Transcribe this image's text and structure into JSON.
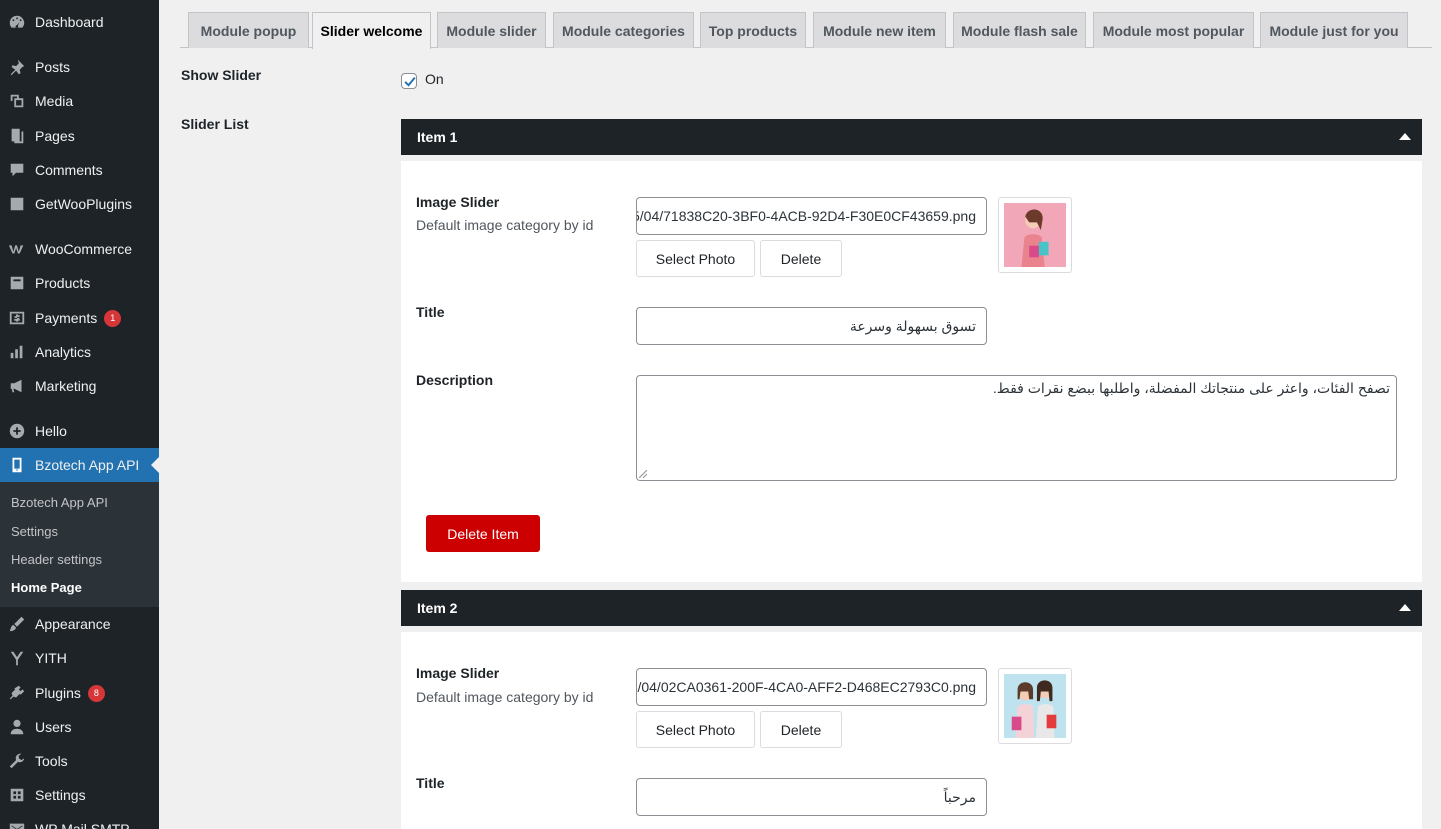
{
  "sidebar": {
    "items": [
      {
        "label": "Dashboard",
        "icon": "dashboard-icon"
      },
      {
        "label": "Posts",
        "icon": "pin-icon"
      },
      {
        "label": "Media",
        "icon": "media-icon"
      },
      {
        "label": "Pages",
        "icon": "pages-icon"
      },
      {
        "label": "Comments",
        "icon": "comment-icon"
      },
      {
        "label": "GetWooPlugins",
        "icon": "chart-icon"
      },
      {
        "label": "WooCommerce",
        "icon": "woo-icon"
      },
      {
        "label": "Products",
        "icon": "archive-icon"
      },
      {
        "label": "Payments",
        "icon": "payment-icon",
        "badge": "1"
      },
      {
        "label": "Analytics",
        "icon": "bar-chart-icon"
      },
      {
        "label": "Marketing",
        "icon": "megaphone-icon"
      },
      {
        "label": "Hello",
        "icon": "plus-circle-icon"
      },
      {
        "label": "Bzotech App API",
        "icon": "mobile-icon"
      },
      {
        "label": "Appearance",
        "icon": "brush-icon"
      },
      {
        "label": "YITH",
        "icon": "yith-icon"
      },
      {
        "label": "Plugins",
        "icon": "plug-icon",
        "badge": "8"
      },
      {
        "label": "Users",
        "icon": "user-icon"
      },
      {
        "label": "Tools",
        "icon": "wrench-icon"
      },
      {
        "label": "Settings",
        "icon": "settings-icon"
      },
      {
        "label": "WP Mail SMTP",
        "icon": "mail-icon"
      }
    ],
    "submenu": [
      "Bzotech App API",
      "Settings",
      "Header settings",
      "Home Page"
    ]
  },
  "tabs": [
    "Module popup",
    "Slider welcome",
    "Module slider",
    "Module categories",
    "Top products",
    "Module new item",
    "Module flash sale",
    "Module most popular",
    "Module just for you"
  ],
  "form": {
    "show_slider_label": "Show Slider",
    "show_slider_value": "On",
    "slider_list_label": "Slider List"
  },
  "items": [
    {
      "header": "Item 1",
      "image_label": "Image Slider",
      "image_desc": "Default image category by id",
      "image_url": "https://demo.bzotech.com/wp-content/uploads/2025/04/71838C20-3BF0-4ACB-92D4-F30E0CF43659.png",
      "select_photo": "Select Photo",
      "delete": "Delete",
      "title_label": "Title",
      "title_value": "تسوق بسهولة وسرعة",
      "description_label": "Description",
      "description_value": "تصفح الفئات، واعثر على منتجاتك المفضلة، واطلبها ببضع نقرات فقط.",
      "delete_item": "Delete Item"
    },
    {
      "header": "Item 2",
      "image_label": "Image Slider",
      "image_desc": "Default image category by id",
      "image_url": "https://demo.bzotech.com/wp-content/uploads/2025/04/02CA0361-200F-4CA0-AFF2-D468EC2793C0.png",
      "select_photo": "Select Photo",
      "delete": "Delete",
      "title_label": "Title",
      "title_value": "مرحباً"
    }
  ]
}
